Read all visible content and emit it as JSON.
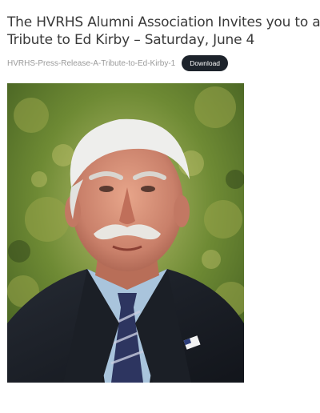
{
  "post": {
    "title": "The HVRHS Alumni Association Invites you to a Tribute to Ed Kirby – Saturday, June 4"
  },
  "attachment": {
    "filename": "HVRHS-Press-Release-A-Tribute-to-Ed-Kirby-1",
    "download_label": "Download"
  },
  "colors": {
    "title_text": "#3a3a3a",
    "link_text": "#9a9a9a",
    "button_bg": "#1d232b",
    "button_text": "#ffffff"
  }
}
